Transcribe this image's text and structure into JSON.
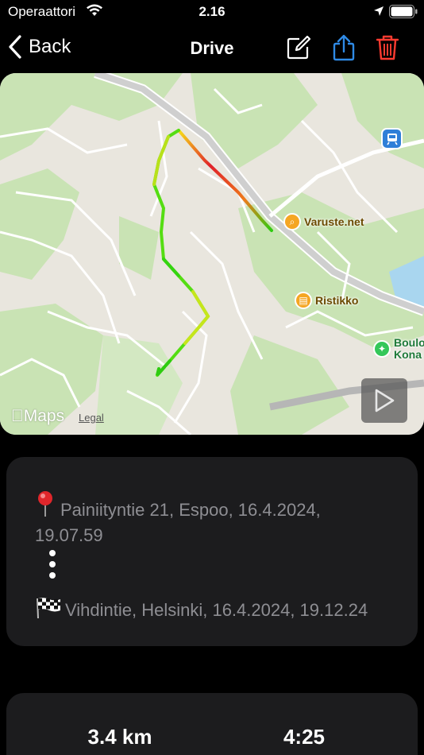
{
  "status_bar": {
    "carrier": "Operaattori",
    "time": "2.16"
  },
  "nav": {
    "back_label": "Back",
    "title": "Drive",
    "icons": [
      "chevron-left-icon",
      "edit-icon",
      "share-icon",
      "trash-icon"
    ],
    "colors": {
      "share": "#2f8ae5",
      "delete": "#ff3b30"
    }
  },
  "map": {
    "pois": [
      {
        "name": "Varuste.net",
        "icon": "store-icon",
        "color": "#f5a623"
      },
      {
        "name": "Ristikko",
        "icon": "restaurant-icon",
        "color": "#f5a623"
      },
      {
        "name": "Boulo Kona",
        "icon": "climbing-icon",
        "color": "#34c759"
      }
    ],
    "transit_icon": "train-icon",
    "brand": "Maps",
    "legal": "Legal",
    "route_colors": {
      "fast": "#2ecc10",
      "mid": "#f7e01a",
      "slow": "#e0212a"
    }
  },
  "route": {
    "start": "Painiityntie 21, Espoo, 16.4.2024, 19.07.59",
    "end": "Vihdintie, Helsinki, 16.4.2024, 19.12.24"
  },
  "stats": {
    "distance": "3.4 km",
    "duration": "4:25"
  }
}
